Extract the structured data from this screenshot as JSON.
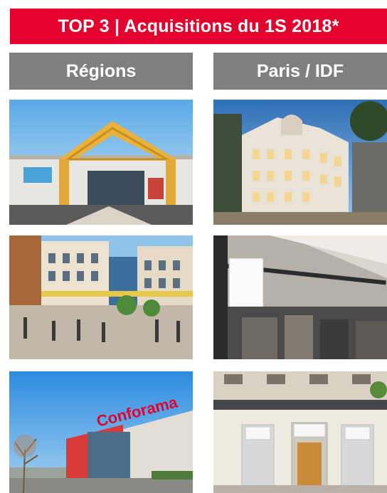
{
  "banner": {
    "title": "TOP 3 | Acquisitions du 1S 2018*"
  },
  "columns": [
    {
      "label": "Régions"
    },
    {
      "label": "Paris / IDF"
    }
  ],
  "photos": {
    "regions": [
      {
        "subject": "shopping-mall-golden-arch-entrance"
      },
      {
        "subject": "mixed-use-development-pedestrian-plaza"
      },
      {
        "subject": "conforama-store-red-facade",
        "sign_text": "Conforama"
      }
    ],
    "paris": [
      {
        "subject": "haussmann-building-corner-dusk"
      },
      {
        "subject": "boutique-hanging-sign-storefront"
      },
      {
        "subject": "haussmann-ground-floor-shopfront"
      }
    ]
  },
  "colors": {
    "banner_red": "#e3022d",
    "header_grey": "#7f7f7f"
  }
}
